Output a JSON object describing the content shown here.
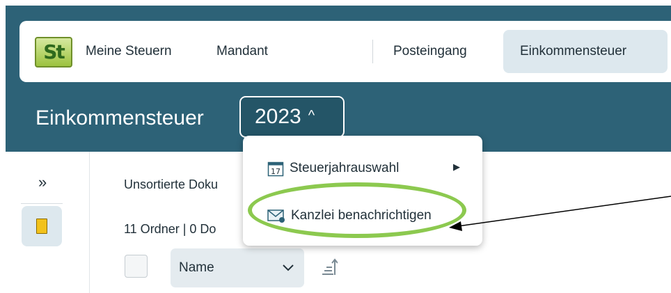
{
  "nav": {
    "logo_text": "St",
    "items": [
      {
        "label": "Meine Steuern"
      },
      {
        "label": "Mandant"
      },
      {
        "label": "Posteingang"
      },
      {
        "label": "Einkommensteuer",
        "active": true
      }
    ]
  },
  "header": {
    "title": "Einkommensteuer",
    "year": "2023",
    "year_caret": "^"
  },
  "rail": {
    "expand_label": "»"
  },
  "content": {
    "unsorted_label": "Unsortierte Doku",
    "count_label": "11 Ordner | 0 Do",
    "sort": {
      "selected": "Name"
    }
  },
  "menu": {
    "items": [
      {
        "label": "Steuerjahrauswahl",
        "icon": "calendar-icon",
        "calendar_number": "17",
        "has_submenu": true
      },
      {
        "label": "Kanzlei benachrichtigen",
        "icon": "mail-icon"
      }
    ]
  },
  "colors": {
    "header_teal": "#2d6277",
    "highlight_green": "#8cc94f",
    "active_tab": "#dde8ee",
    "folder_yellow": "#f2c21b"
  }
}
